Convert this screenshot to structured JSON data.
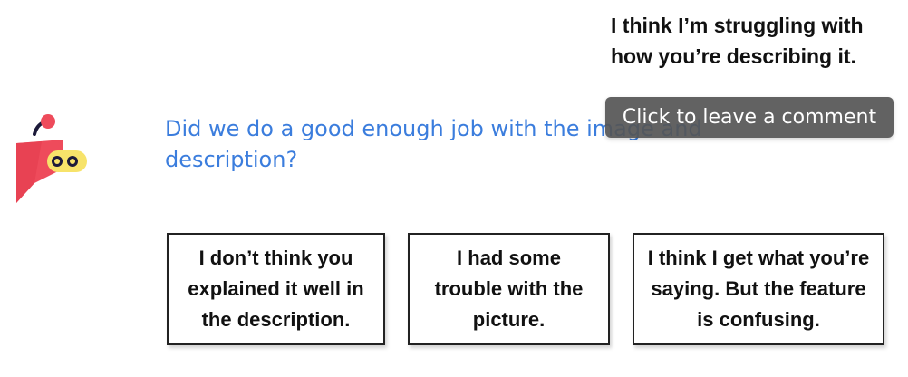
{
  "comment_text": "I think I’m struggling with how you’re describing it.",
  "tooltip": {
    "label": "Click to leave a comment"
  },
  "question": {
    "text": "Did we do a good enough job with the image and description?"
  },
  "answers": [
    {
      "label": "I don’t think you explained it well in the description."
    },
    {
      "label": "I had some trouble with the picture."
    },
    {
      "label": "I think I get what you’re saying. But the feature is confusing."
    }
  ],
  "colors": {
    "question": "#3b7ddd",
    "bot_body": "#ee4b5b",
    "bot_visor": "#f7e36a",
    "bot_outline": "#1c1a3a",
    "tooltip_bg": "#555555"
  },
  "icons": {
    "bot": "robot-mascot-icon"
  }
}
